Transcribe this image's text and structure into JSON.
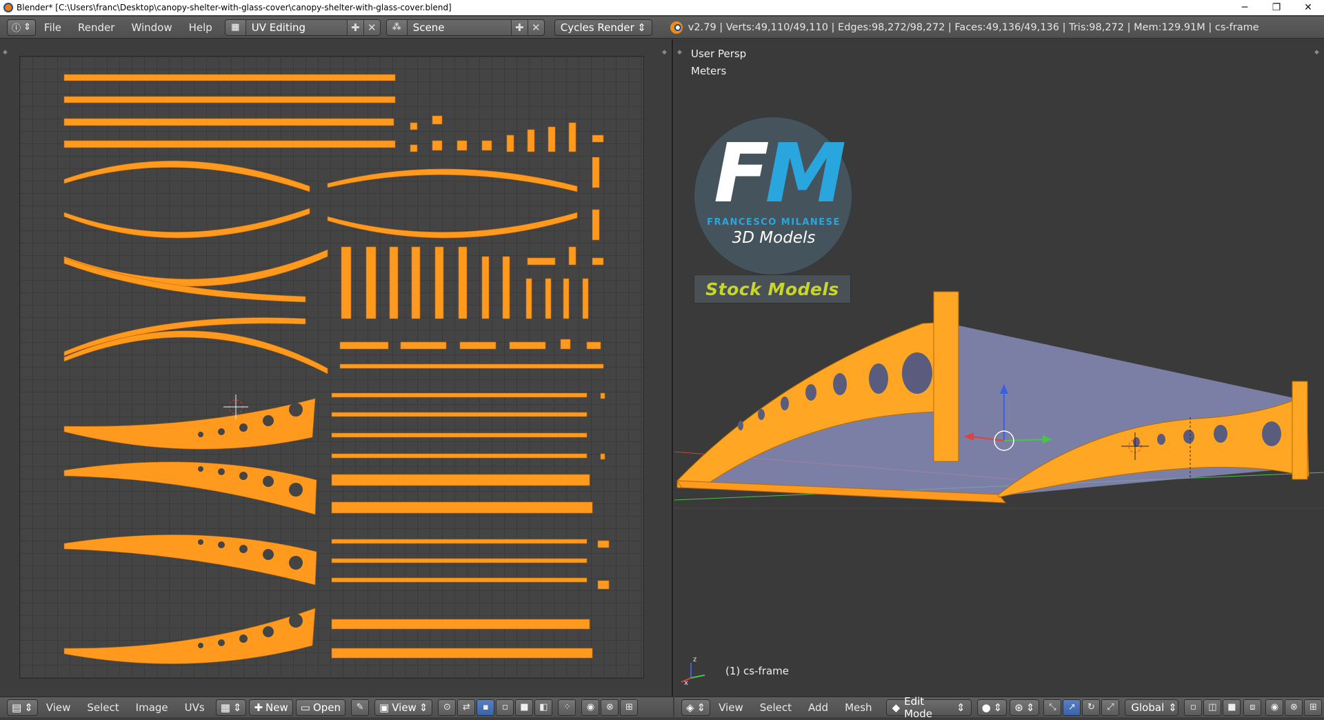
{
  "window": {
    "title": "Blender* [C:\\Users\\franc\\Desktop\\canopy-shelter-with-glass-cover\\canopy-shelter-with-glass-cover.blend]",
    "minimize": "─",
    "maximize": "❐",
    "close": "✕"
  },
  "info_header": {
    "menus": [
      "File",
      "Render",
      "Window",
      "Help"
    ],
    "screen_layout": "UV Editing",
    "scene": "Scene",
    "render_engine": "Cycles Render",
    "stats": "v2.79 | Verts:49,110/49,110 | Edges:98,272/98,272 | Faces:49,136/49,136 | Tris:98,272 | Mem:129.91M | cs-frame"
  },
  "uv_editor": {
    "menus": [
      "View",
      "Select",
      "Image",
      "UVs"
    ],
    "new_label": "New",
    "open_label": "Open",
    "view_label": "View"
  },
  "viewport": {
    "perspective_label": "User Persp",
    "units_label": "Meters",
    "object_label": "(1) cs-frame",
    "menus": [
      "View",
      "Select",
      "Add",
      "Mesh"
    ],
    "mode": "Edit Mode",
    "orientation": "Global",
    "axis_x": "x",
    "axis_z": "z"
  },
  "logo": {
    "letter_f": "F",
    "letter_m": "M",
    "brand": "FRANCESCO MILANESE",
    "tagline": "3D Models",
    "badge": "Stock Models"
  },
  "colors": {
    "uv_island": "#ff9a1f",
    "mesh_wire": "#ffa624",
    "glass": "#8f93c4",
    "axis_red": "#e0413a",
    "axis_green": "#4cc14c",
    "axis_blue": "#3a5fe0"
  }
}
